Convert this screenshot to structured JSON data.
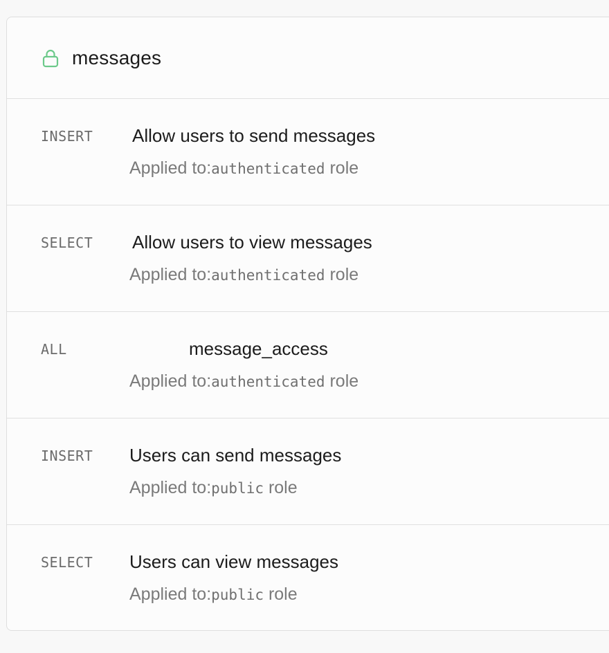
{
  "table": {
    "name": "messages",
    "lock_icon_color": "#6cc98a"
  },
  "policies": [
    {
      "command": "INSERT",
      "name": "Allow users to send messages",
      "applied_prefix": "Applied to:",
      "role": "authenticated",
      "role_suffix": " role"
    },
    {
      "command": "SELECT",
      "name": "Allow users to view messages",
      "applied_prefix": "Applied to:",
      "role": "authenticated",
      "role_suffix": " role"
    },
    {
      "command": "ALL",
      "name": "message_access",
      "applied_prefix": "Applied to:",
      "role": "authenticated",
      "role_suffix": " role"
    },
    {
      "command": "INSERT",
      "name": "Users can send messages",
      "applied_prefix": "Applied to:",
      "role": "public",
      "role_suffix": " role"
    },
    {
      "command": "SELECT",
      "name": "Users can view messages",
      "applied_prefix": "Applied to:",
      "role": "public",
      "role_suffix": " role"
    }
  ]
}
